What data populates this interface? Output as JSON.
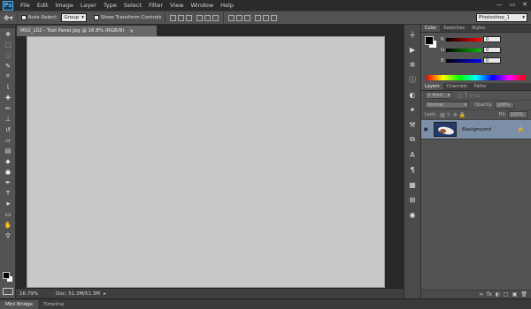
{
  "app": {
    "logo_text": "Ps"
  },
  "menu": [
    "File",
    "Edit",
    "Image",
    "Layer",
    "Type",
    "Select",
    "Filter",
    "View",
    "Window",
    "Help"
  ],
  "window_controls": {
    "minimize": "—",
    "restore": "▭",
    "close": "✕"
  },
  "options": {
    "auto_select_label": "Auto-Select:",
    "auto_select_value": "Group",
    "transform_label": "Show Transform Controls"
  },
  "workspace": "Photoshop_1",
  "document": {
    "tab_title": "M02_L02 - Tool Panel.jpg @ 16.8% (RGB/8)",
    "close_glyph": "×",
    "zoom": "16.79%",
    "doc_info": "Doc: 51.3M/51.3M",
    "status_arrow": "▸"
  },
  "tools": [
    {
      "name": "move",
      "glyph": "✥"
    },
    {
      "name": "marquee",
      "glyph": "⬚"
    },
    {
      "name": "lasso",
      "glyph": "◌"
    },
    {
      "name": "quick-select",
      "glyph": "✎"
    },
    {
      "name": "crop",
      "glyph": "⌗"
    },
    {
      "name": "eyedropper",
      "glyph": "⌇"
    },
    {
      "name": "spot-heal",
      "glyph": "✚"
    },
    {
      "name": "brush",
      "glyph": "✏"
    },
    {
      "name": "clone-stamp",
      "glyph": "⊥"
    },
    {
      "name": "history-brush",
      "glyph": "↺"
    },
    {
      "name": "eraser",
      "glyph": "▱"
    },
    {
      "name": "gradient",
      "glyph": "▤"
    },
    {
      "name": "blur",
      "glyph": "◆"
    },
    {
      "name": "dodge",
      "glyph": "●"
    },
    {
      "name": "pen",
      "glyph": "✒"
    },
    {
      "name": "type",
      "glyph": "T"
    },
    {
      "name": "path-select",
      "glyph": "➤"
    },
    {
      "name": "shape",
      "glyph": "▭"
    },
    {
      "name": "hand",
      "glyph": "✋"
    },
    {
      "name": "zoom",
      "glyph": "⚲"
    }
  ],
  "dock_icons": [
    {
      "name": "history",
      "glyph": "⏚"
    },
    {
      "name": "actions",
      "glyph": "▶"
    },
    {
      "name": "navigator",
      "glyph": "✲"
    },
    {
      "name": "info",
      "glyph": "ⓘ"
    },
    {
      "name": "adjustments",
      "glyph": "◐"
    },
    {
      "name": "brush-presets",
      "glyph": "✦"
    },
    {
      "name": "tool-presets",
      "glyph": "⚒"
    },
    {
      "name": "clone-source",
      "glyph": "⧉"
    },
    {
      "name": "character",
      "glyph": "A"
    },
    {
      "name": "paragraph",
      "glyph": "¶"
    },
    {
      "name": "styles",
      "glyph": "▦"
    },
    {
      "name": "swatches",
      "glyph": "⊞"
    },
    {
      "name": "3d",
      "glyph": "◉"
    }
  ],
  "color_panel": {
    "tabs": [
      "Color",
      "Swatches",
      "Styles"
    ],
    "sliders": [
      {
        "label": "R",
        "value": "0",
        "color": "#ff0000"
      },
      {
        "label": "G",
        "value": "0",
        "color": "#00c000"
      },
      {
        "label": "B",
        "value": "0",
        "color": "#0000ff"
      }
    ]
  },
  "layers_panel": {
    "tabs": [
      "Layers",
      "Channels",
      "Paths"
    ],
    "kind_label": "Kind",
    "blend_mode": "Normal",
    "opacity_label": "Opacity:",
    "opacity_value": "100%",
    "lock_label": "Lock:",
    "fill_label": "Fill:",
    "fill_value": "100%",
    "layer_name": "Background",
    "eye_glyph": "◉",
    "lock_glyph": "🔒",
    "bottom_icons": [
      "∞",
      "fx",
      "◐",
      "▢",
      "▣",
      "🗑"
    ]
  },
  "bottom_tabs": [
    "Mini Bridge",
    "Timeline"
  ]
}
